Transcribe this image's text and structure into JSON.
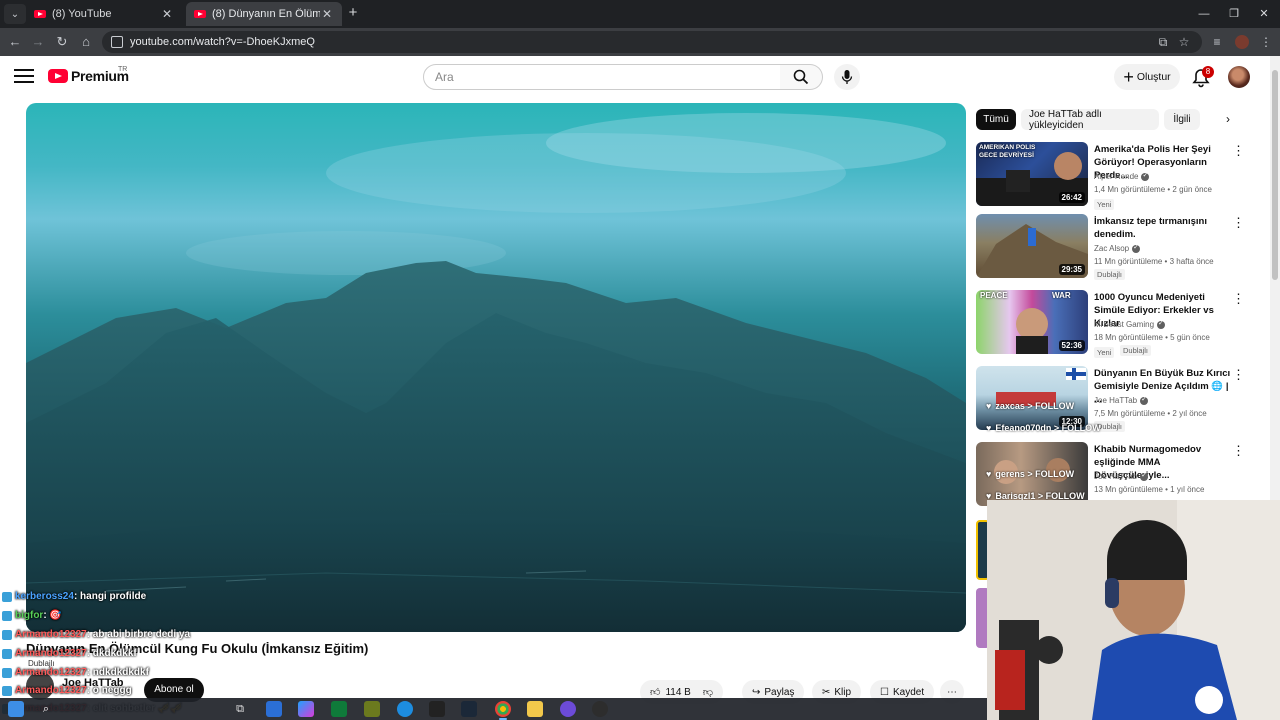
{
  "browser": {
    "tabs": [
      {
        "title": "(8) YouTube",
        "close": "✕"
      },
      {
        "title": "(8) Dünyanın En Ölümcül Kung",
        "close": "✕"
      }
    ],
    "new_tab": "+",
    "url": "youtube.com/watch?v=-DhoeKJxmeQ"
  },
  "yt_header": {
    "logo": "Premium",
    "country": "TR",
    "search_placeholder": "Ara",
    "create_label": "Oluştur",
    "notifications_count": "8"
  },
  "video": {
    "title": "Dünyanın En Ölümcül Kung Fu Okulu (İmkansız Eğitim)",
    "channel": "Joe HaTTab",
    "subscribe_label": "Abone ol",
    "likes": "114 B",
    "share_label": "Paylaş",
    "clip_label": "Klip",
    "save_label": "Kaydet",
    "more": "⋯"
  },
  "chips": [
    "Tümü",
    "Joe HaTTab adlı yükleyiciden",
    "İlgili"
  ],
  "recommendations": [
    {
      "title": "Amerika'da Polis Her Şeyi Görüyor! Operasyonların Perde...",
      "channel": "Alper Rende",
      "meta": "1,4 Mn görüntüleme • 2 gün önce",
      "duration": "26:42",
      "badges": [
        "Yeni"
      ]
    },
    {
      "title": "İmkansız tepe tırmanışını denedim.",
      "channel": "Zac Alsop",
      "meta": "11 Mn görüntüleme • 3 hafta önce",
      "duration": "29:35",
      "badges": [
        "Dublajlı"
      ]
    },
    {
      "title": "1000 Oyuncu Medeniyeti Simüle Ediyor: Erkekler vs Kızlar",
      "channel": "MrBeast Gaming",
      "meta": "18 Mn görüntüleme • 5 gün önce",
      "duration": "52:36",
      "badges": [
        "Yeni",
        "Dublajlı"
      ],
      "thumb_text": [
        "PEACE",
        "WAR"
      ]
    },
    {
      "title": "Dünyanın En Büyük Buz Kırıcı Gemisiyle Denize Açıldım 🌐 | ...",
      "channel": "Joe HaTTab",
      "meta": "7,5 Mn görüntüleme • 2 yıl önce",
      "duration": "12:30",
      "badges": [
        "Dublajlı"
      ]
    },
    {
      "title": "Khabib Nurmagomedov eşliğinde MMA Dövüşçüleriyle...",
      "channel": "Joe HaTTab",
      "meta": "13 Mn görüntüleme • 1 yıl önce",
      "duration": "",
      "badges": []
    }
  ],
  "thumb_texts": {
    "rec1": "AMERIKAN POLIS GECE DEVRİYESİ",
    "rec3_left": "PEACE",
    "rec3_right": "WAR"
  },
  "stream_overlay": {
    "chat": [
      {
        "user": "kerbeross24",
        "text": ": hangi profilde"
      },
      {
        "user": "bigfor",
        "text": ": 🎯"
      },
      {
        "user": "Armando12327",
        "text": ": ab abi birbre dedi ya"
      },
      {
        "user": "Armando12327",
        "text": ": dkdkdkkf"
      },
      {
        "user": "",
        "text": "Dublajlı"
      },
      {
        "user": "Armando12327",
        "text": ": ndkdkdkdkf"
      },
      {
        "user": "Armando12327",
        "text": ": o neggg"
      },
      {
        "user": "Armando12327",
        "text": ": elit sohbetler 🎺🎺"
      }
    ],
    "follows": [
      {
        "text": "zaxcas > FOLLOW"
      },
      {
        "text": "Efeano070dn > FOLLOW"
      },
      {
        "text": "gerens > FOLLOW"
      },
      {
        "text": "Barisqzl1 > FOLLOW"
      }
    ]
  },
  "colors": {
    "accent": "#ff0033",
    "chip_active": "#0f0f0f",
    "chip_bg": "#f2f2f2"
  }
}
